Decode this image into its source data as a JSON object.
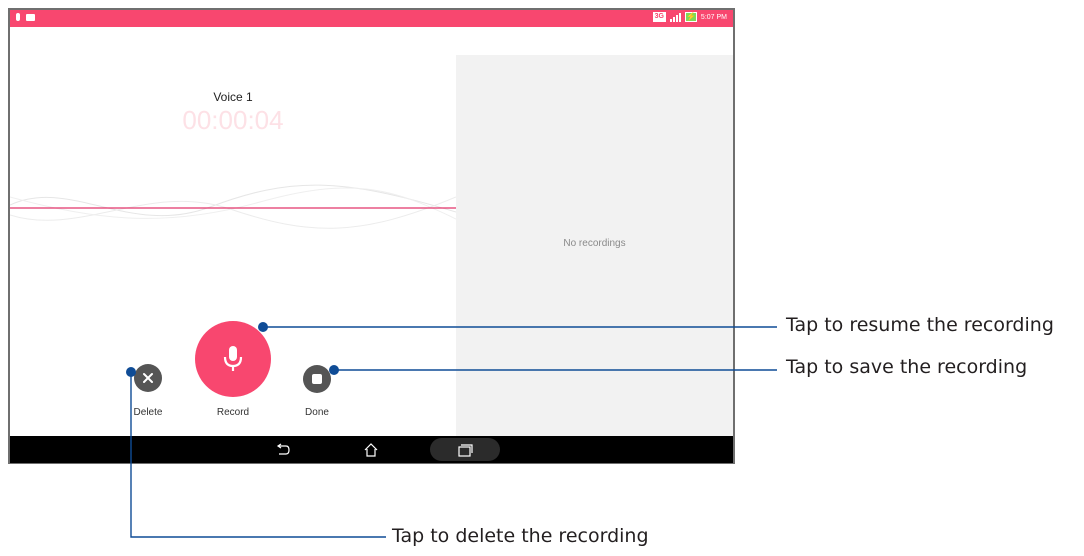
{
  "status_bar": {
    "network": "3G",
    "battery": "⚡",
    "time": "5:07 PM"
  },
  "recorder": {
    "title": "Voice 1",
    "timer": "00:00:04"
  },
  "controls": {
    "delete_label": "Delete",
    "record_label": "Record",
    "done_label": "Done"
  },
  "recordings_list": {
    "empty_text": "No recordings"
  },
  "callouts": {
    "resume": "Tap to resume the recording",
    "save": "Tap to save the recording",
    "delete": "Tap to delete the recording"
  },
  "colors": {
    "accent": "#f8476f",
    "callout_line": "#0f4c96",
    "control_dark": "#555555"
  }
}
